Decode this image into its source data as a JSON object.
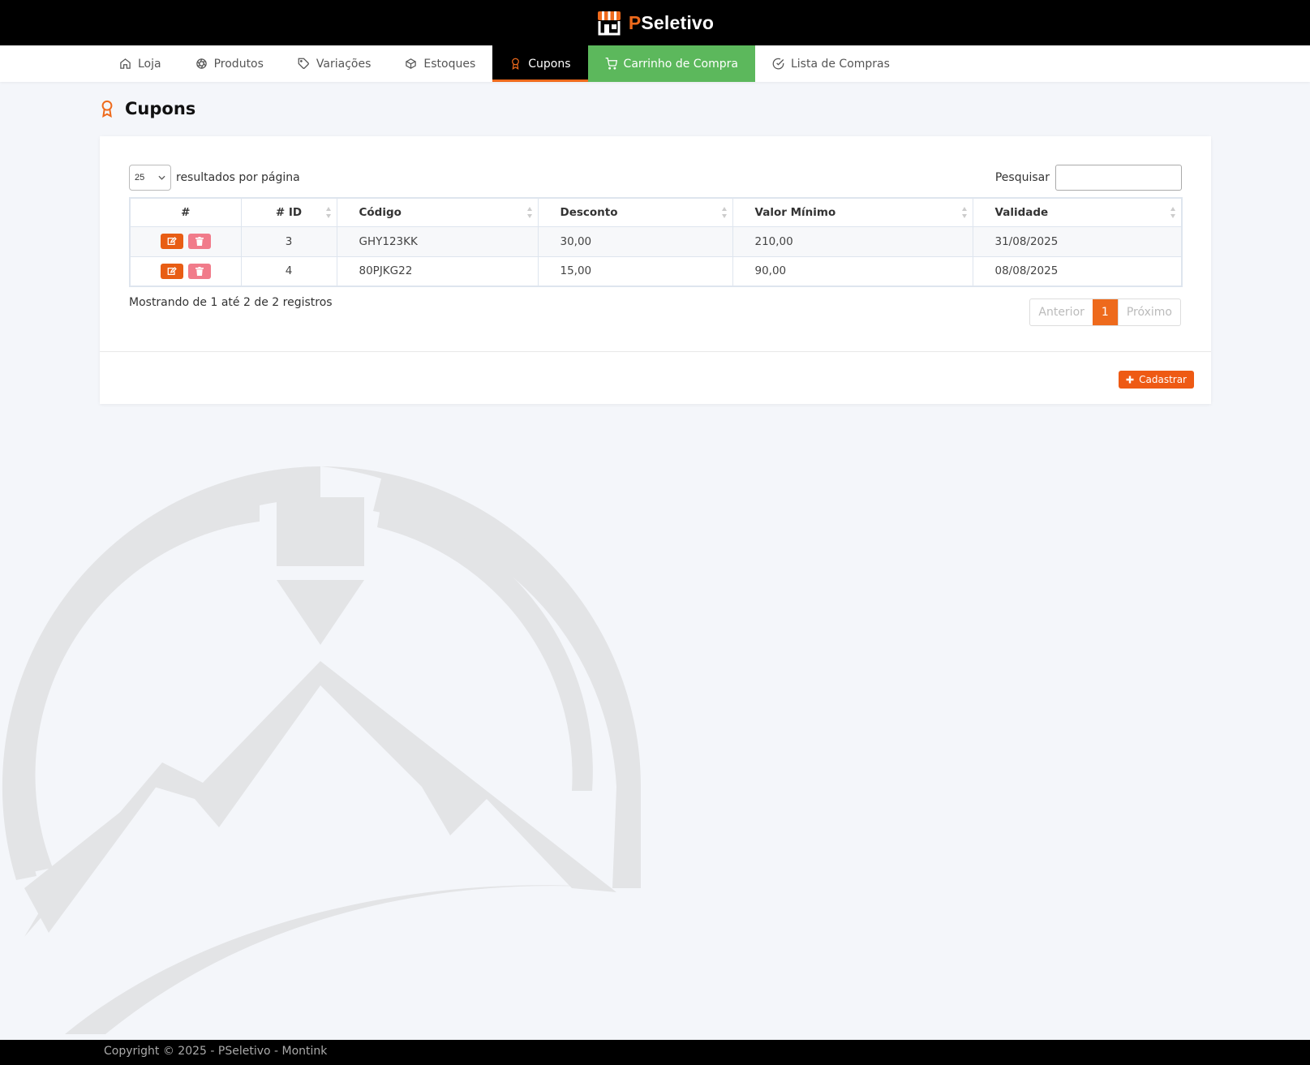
{
  "brand": {
    "prefix": "P",
    "rest": "Seletivo"
  },
  "nav": {
    "items": [
      {
        "label": "Loja",
        "icon": "home-icon"
      },
      {
        "label": "Produtos",
        "icon": "aperture-icon"
      },
      {
        "label": "Variações",
        "icon": "tag-icon"
      },
      {
        "label": "Estoques",
        "icon": "box-icon"
      },
      {
        "label": "Cupons",
        "icon": "award-icon",
        "active": true
      },
      {
        "label": "Carrinho de Compra",
        "icon": "cart-icon"
      },
      {
        "label": "Lista de Compras",
        "icon": "check-circle-icon"
      }
    ]
  },
  "page": {
    "title": "Cupons"
  },
  "table_controls": {
    "page_length": "25",
    "page_length_label": "resultados por página",
    "search_label": "Pesquisar",
    "search_value": ""
  },
  "table": {
    "headers": [
      "#",
      "# ID",
      "Código",
      "Desconto",
      "Valor Mínimo",
      "Validade"
    ],
    "rows": [
      {
        "id": "3",
        "codigo": "GHY123KK",
        "desconto": "30,00",
        "valor_minimo": "210,00",
        "validade": "31/08/2025"
      },
      {
        "id": "4",
        "codigo": "80PJKG22",
        "desconto": "15,00",
        "valor_minimo": "90,00",
        "validade": "08/08/2025"
      }
    ]
  },
  "info": "Mostrando de 1 até 2 de 2 registros",
  "pagination": {
    "previous": "Anterior",
    "current": "1",
    "next": "Próximo"
  },
  "actions": {
    "create_label": "Cadastrar"
  },
  "footer": {
    "text": "Copyright © 2025 - PSeletivo - Montink"
  },
  "colors": {
    "accent": "#ee6a1c",
    "cart": "#5cb85c",
    "delete": "#f17b8a"
  }
}
